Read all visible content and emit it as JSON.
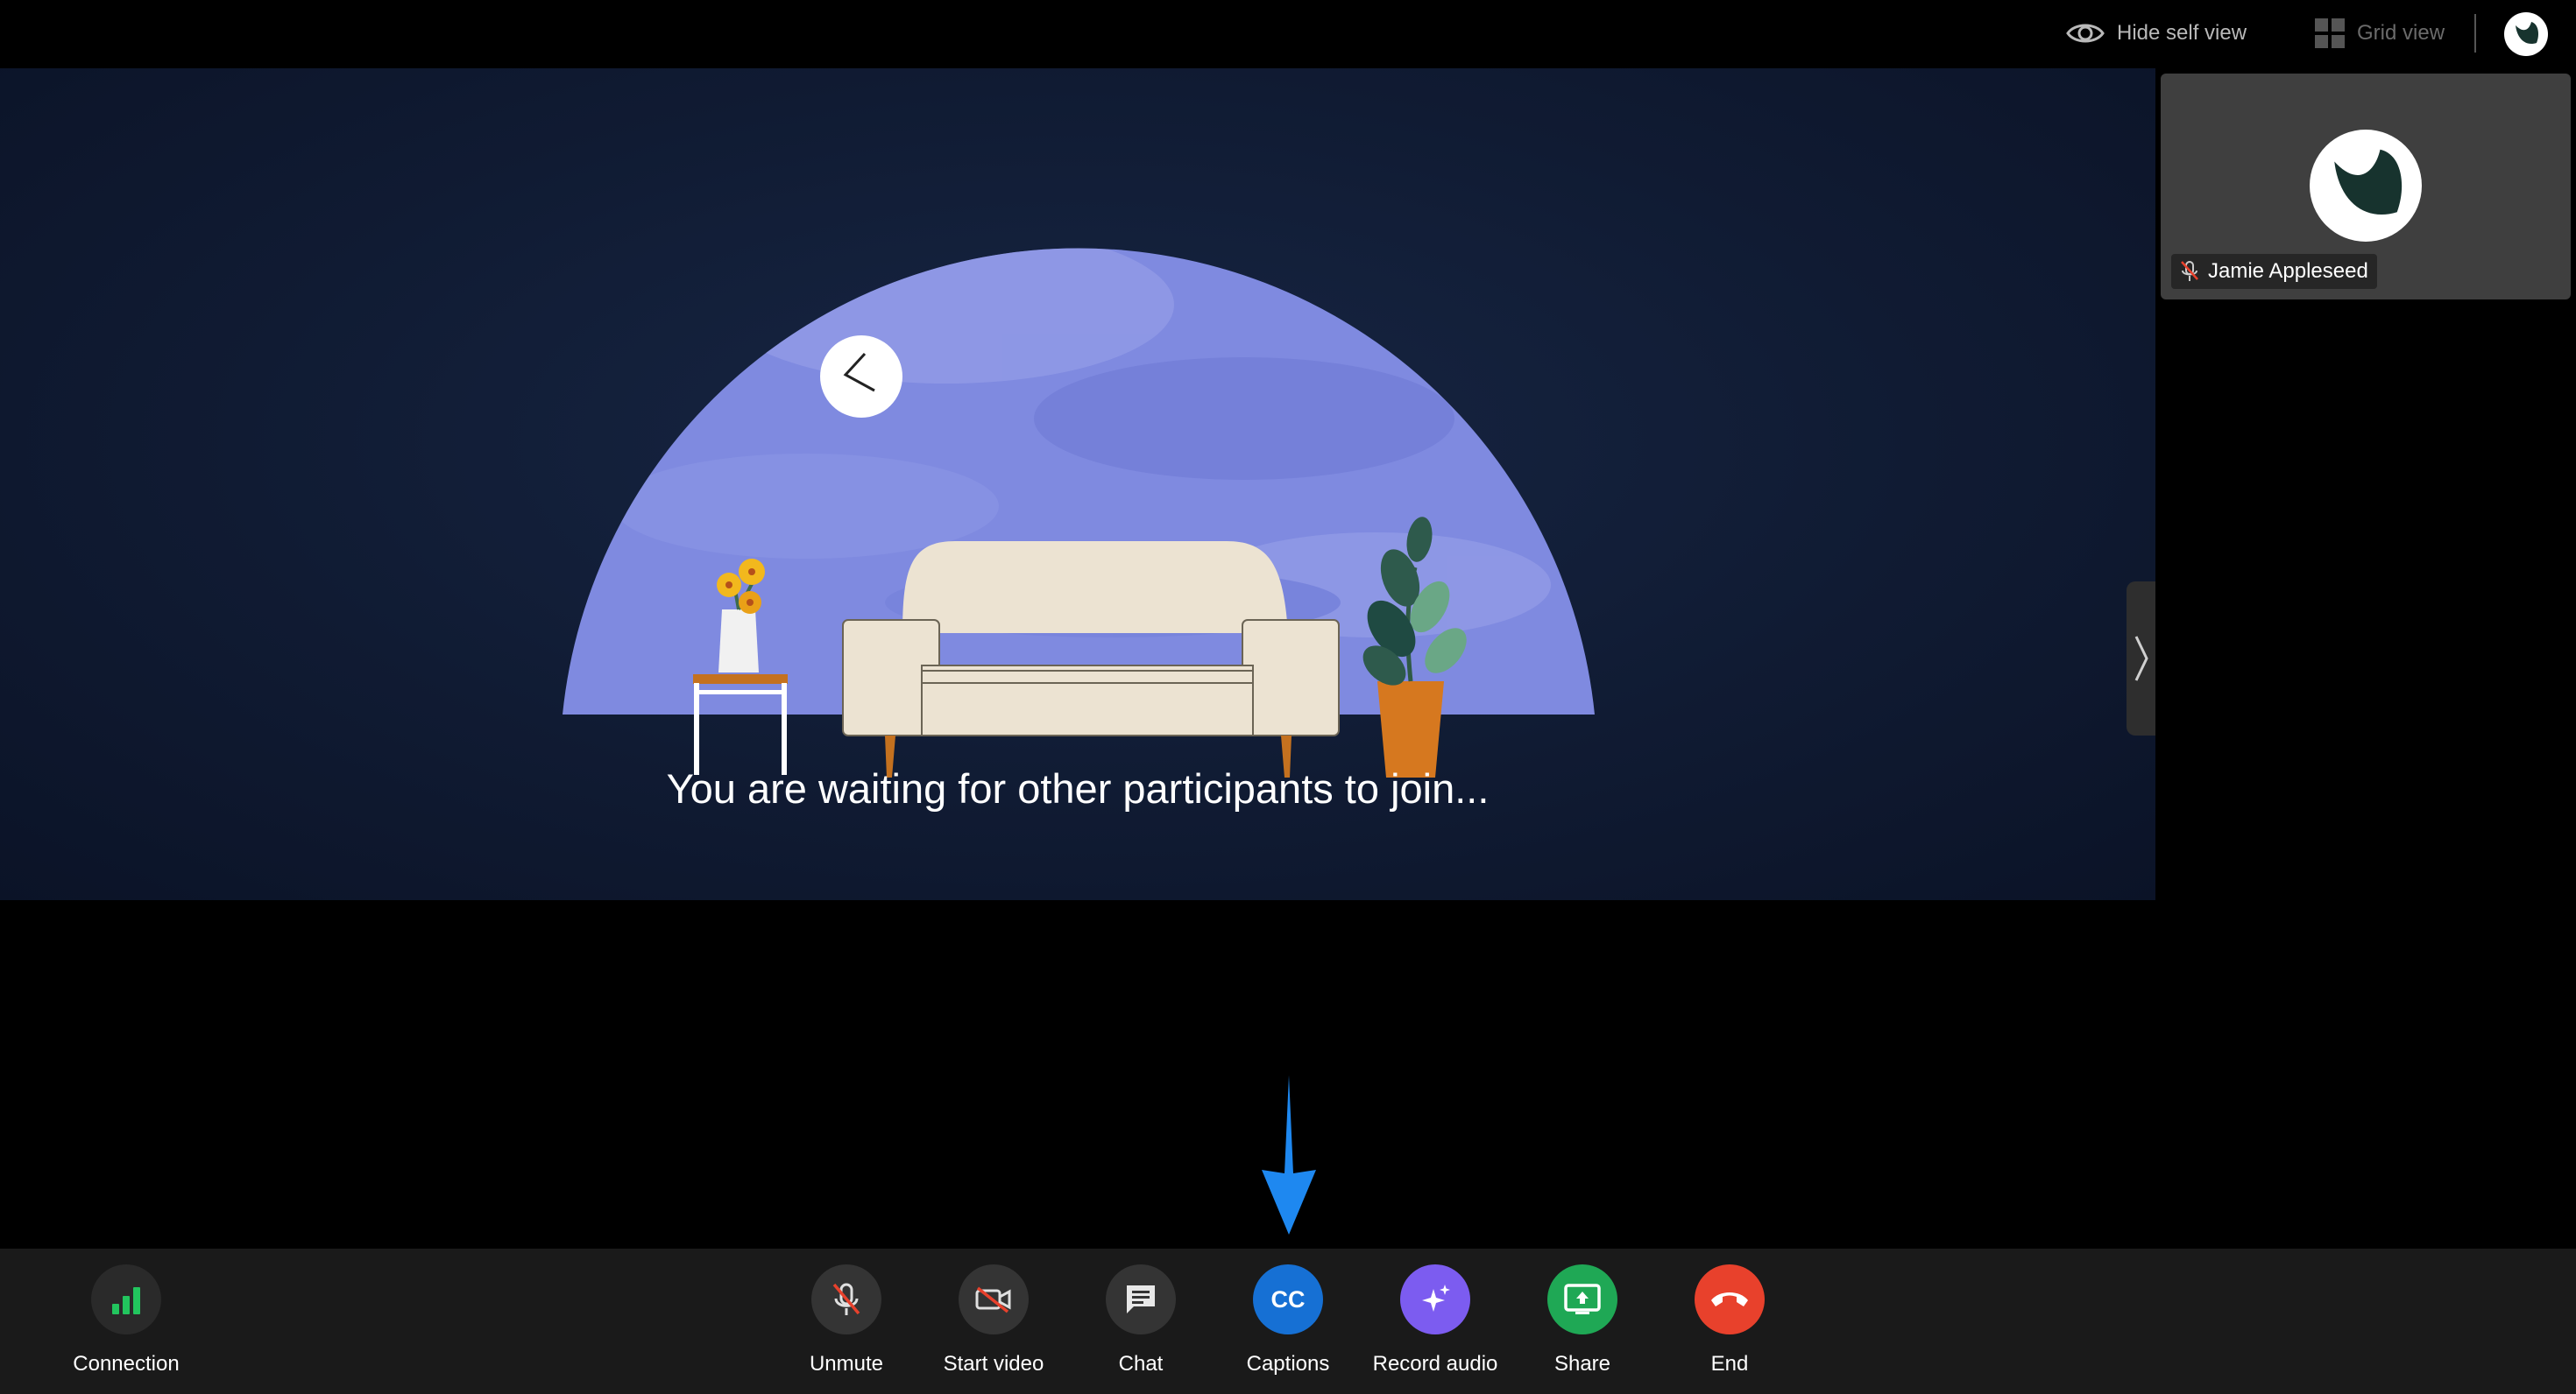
{
  "top_bar": {
    "hide_self_view_label": "Hide self view",
    "grid_view_label": "Grid view",
    "hide_self_view_icon": "eye-icon",
    "grid_view_icon": "grid-icon",
    "logo_icon": "webex-logo-icon"
  },
  "stage": {
    "waiting_message": "You are waiting for other participants to join...",
    "illustration": "waiting-room-illustration"
  },
  "self_view": {
    "participant_name": "Jamie Appleseed",
    "muted_icon": "mic-muted-icon"
  },
  "toolbar": {
    "connection": {
      "label": "Connection",
      "icon": "signal-bars-icon",
      "color": "#22c55e"
    },
    "unmute": {
      "label": "Unmute",
      "icon": "mic-muted-icon",
      "color": "#343434"
    },
    "start_video": {
      "label": "Start video",
      "icon": "video-off-icon",
      "color": "#343434"
    },
    "chat": {
      "label": "Chat",
      "icon": "chat-icon",
      "color": "#343434"
    },
    "captions": {
      "label": "Captions",
      "icon_text": "CC",
      "color": "#1670d4"
    },
    "record_audio": {
      "label": "Record audio",
      "icon": "sparkle-icon",
      "color": "#7c5cf0"
    },
    "share": {
      "label": "Share",
      "icon": "share-screen-icon",
      "color": "#1fa855"
    },
    "end": {
      "label": "End",
      "icon": "hang-up-icon",
      "color": "#e8412c"
    }
  },
  "annotation": {
    "arrow_color": "#1e88f0",
    "arrow_target": "captions"
  }
}
